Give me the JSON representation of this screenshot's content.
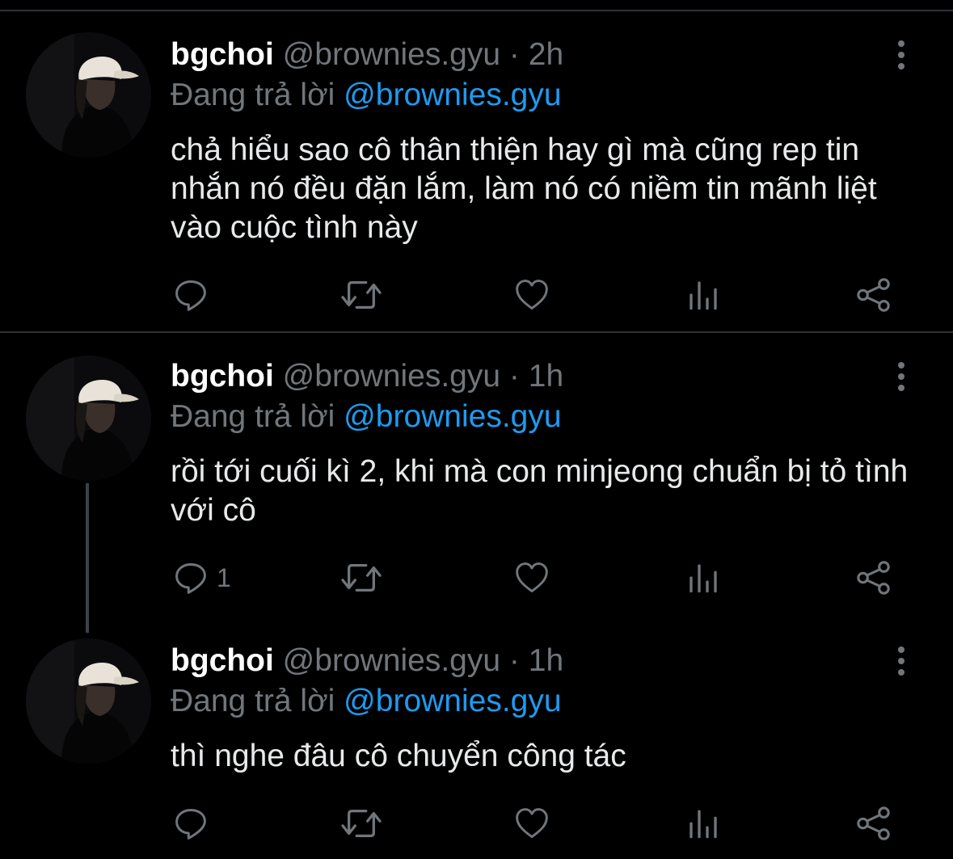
{
  "colors": {
    "background": "#000000",
    "text": "#e7e9ea",
    "muted": "#71767b",
    "link": "#1d9bf0",
    "divider": "#2f3336"
  },
  "tweets": [
    {
      "name": "bgchoi",
      "handle": "@brownies.gyu",
      "separator": "·",
      "time": "2h",
      "reply_prefix": "Đang trả lời",
      "reply_to": "@brownies.gyu",
      "text": "chả hiểu sao cô thân thiện hay gì mà cũng rep tin nhắn nó đều đặn lắm, làm nó có niềm tin mãnh liệt vào cuộc tình này",
      "reply_count": "",
      "icons": [
        "reply-icon",
        "retweet-icon",
        "like-icon",
        "analytics-icon",
        "share-icon"
      ]
    },
    {
      "name": "bgchoi",
      "handle": "@brownies.gyu",
      "separator": "·",
      "time": "1h",
      "reply_prefix": "Đang trả lời",
      "reply_to": "@brownies.gyu",
      "text": "rồi tới cuối kì 2, khi mà con minjeong chuẩn bị tỏ tình với cô",
      "reply_count": "1",
      "icons": [
        "reply-icon",
        "retweet-icon",
        "like-icon",
        "analytics-icon",
        "share-icon"
      ]
    },
    {
      "name": "bgchoi",
      "handle": "@brownies.gyu",
      "separator": "·",
      "time": "1h",
      "reply_prefix": "Đang trả lời",
      "reply_to": "@brownies.gyu",
      "text": "thì nghe đâu cô chuyển công tác",
      "reply_count": "",
      "icons": [
        "reply-icon",
        "retweet-icon",
        "like-icon",
        "analytics-icon",
        "share-icon"
      ]
    }
  ]
}
